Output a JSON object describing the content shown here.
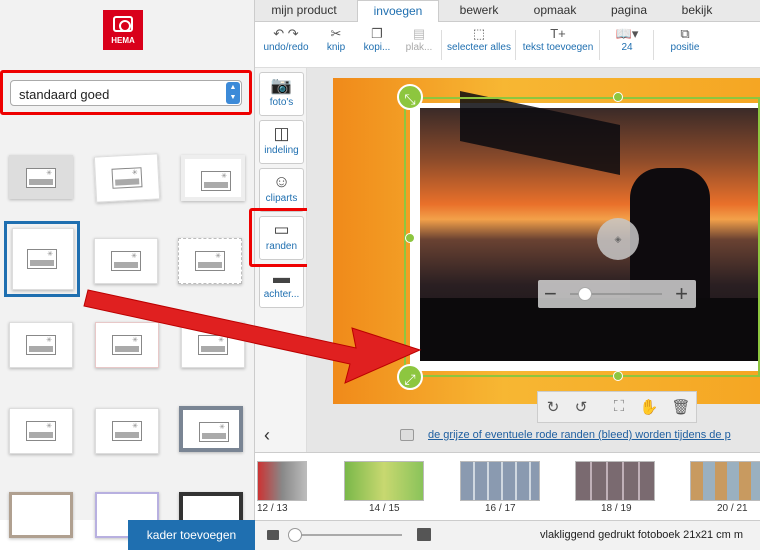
{
  "brand": {
    "logo_text": "HEMA",
    "color": "#d9001b"
  },
  "tabs": [
    {
      "label": "mijn product"
    },
    {
      "label": "invoegen"
    },
    {
      "label": "bewerk"
    },
    {
      "label": "opmaak"
    },
    {
      "label": "pagina"
    },
    {
      "label": "bekijk"
    }
  ],
  "active_tab": "invoegen",
  "toolbar": {
    "undo_redo": "undo/redo",
    "cut": "knip",
    "copy": "kopi...",
    "paste": "plak...",
    "select_all": "selecteer alles",
    "add_text": "tekst toevoegen",
    "page_count": "24",
    "position": "positie"
  },
  "side_tabs": [
    {
      "label": "foto's",
      "icon": "camera-icon"
    },
    {
      "label": "indeling",
      "icon": "layout-icon"
    },
    {
      "label": "cliparts",
      "icon": "smiley-icon"
    },
    {
      "label": "randen",
      "icon": "frame-icon"
    },
    {
      "label": "achter...",
      "icon": "background-icon"
    }
  ],
  "frame_style_select": {
    "value": "standaard goed"
  },
  "add_frame_button": "kader toevoegen",
  "hint_text": "de grijze of eventuele rode randen (bleed) worden tijdens de p",
  "filmstrip": [
    {
      "label": "12 / 13"
    },
    {
      "label": "14 / 15"
    },
    {
      "label": "16 / 17"
    },
    {
      "label": "18 / 19"
    },
    {
      "label": "20 / 21"
    }
  ],
  "status_text": "vlakliggend gedrukt fotoboek 21x21 cm m",
  "colors": {
    "accent": "#1f6fb0",
    "highlight": "#e00000",
    "selection": "#8dc63f",
    "page": "#f5a623"
  }
}
